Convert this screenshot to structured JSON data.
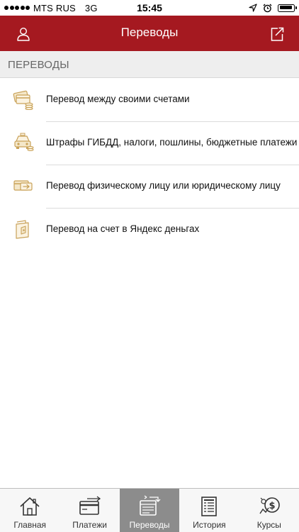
{
  "status_bar": {
    "carrier": "MTS RUS",
    "network": "3G",
    "time": "15:45"
  },
  "nav": {
    "title": "Переводы",
    "left_icon": "profile-icon",
    "right_icon": "logout-icon"
  },
  "section": {
    "title": "ПЕРЕВОДЫ"
  },
  "transfers": {
    "items": [
      {
        "label": "Перевод между своими счетами",
        "icon": "own-accounts-transfer-icon"
      },
      {
        "label": "Штрафы ГИБДД, налоги, пошлины, бюджетные платежи",
        "icon": "taxi-fines-icon"
      },
      {
        "label": "Перевод физическому лицу или юридическому лицу",
        "icon": "card-transfer-icon"
      },
      {
        "label": "Перевод на счет в Яндекс деньгах",
        "icon": "yandex-wallet-icon"
      }
    ]
  },
  "tabs": {
    "items": [
      {
        "label": "Главная",
        "icon": "home-icon"
      },
      {
        "label": "Платежи",
        "icon": "payments-icon"
      },
      {
        "label": "Переводы",
        "icon": "transfers-icon",
        "active": true
      },
      {
        "label": "История",
        "icon": "history-icon"
      },
      {
        "label": "Курсы",
        "icon": "currency-rates-icon"
      }
    ]
  },
  "colors": {
    "brand_red": "#a51920",
    "icon_gold": "#c9a259",
    "active_tab": "#8c8c8c",
    "section_bg": "#eeeeee"
  }
}
